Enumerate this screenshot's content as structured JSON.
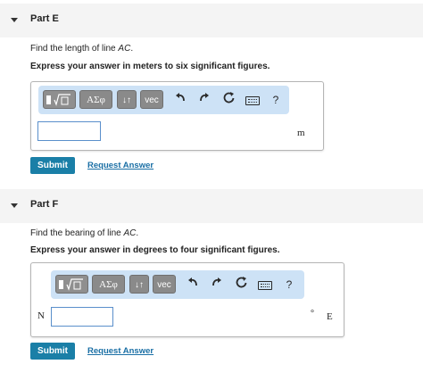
{
  "partE": {
    "title": "Part E",
    "question_pre": "Find the length of line ",
    "question_var": "AC",
    "question_post": ".",
    "instruction": "Express your answer in meters to six significant figures.",
    "toolbar": {
      "templates_icon": "fraction-radical-icon",
      "greek_label": "ΑΣφ",
      "arrows_label": "↓↑",
      "vec_label": "vec",
      "undo_icon": "undo-icon",
      "redo_icon": "redo-icon",
      "reset_icon": "reset-icon",
      "keyboard_icon": "keyboard-icon",
      "help_label": "?"
    },
    "answer_value": "",
    "unit": "m",
    "submit_label": "Submit",
    "request_label": "Request Answer"
  },
  "partF": {
    "title": "Part F",
    "question_pre": "Find the bearing of line ",
    "question_var": "AC",
    "question_post": ".",
    "instruction": "Express your answer in degrees to four significant figures.",
    "toolbar": {
      "templates_icon": "fraction-radical-icon",
      "greek_label": "ΑΣφ",
      "arrows_label": "↓↑",
      "vec_label": "vec",
      "undo_icon": "undo-icon",
      "redo_icon": "redo-icon",
      "reset_icon": "reset-icon",
      "keyboard_icon": "keyboard-icon",
      "help_label": "?"
    },
    "prefix": "N",
    "answer_value": "",
    "degree_symbol": "°",
    "suffix": "E",
    "submit_label": "Submit",
    "request_label": "Request Answer"
  },
  "colors": {
    "header_bg": "#f4f4f4",
    "toolbar_bg": "#cde2f6",
    "button_gray": "#8a8a8a",
    "submit_bg": "#1a7fa7",
    "link": "#1a6fa5",
    "input_border": "#5a8fcb"
  }
}
